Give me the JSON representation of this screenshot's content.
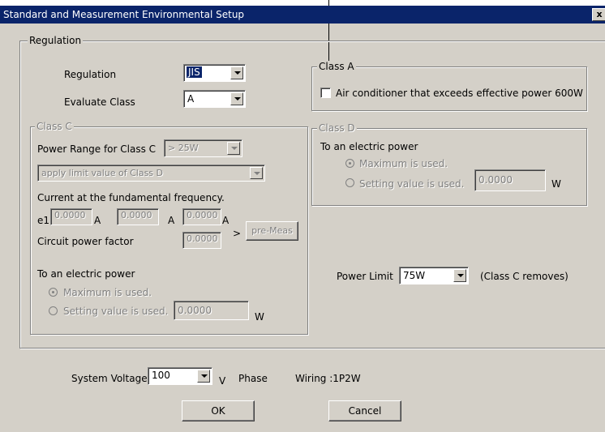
{
  "window": {
    "title": "Standard and Measurement Environmental Setup",
    "close_glyph": "x"
  },
  "regulation_group": {
    "title": "Regulation",
    "regulation_label": "Regulation",
    "regulation_value": "JIS",
    "evaluate_label": "Evaluate Class",
    "evaluate_value": "A"
  },
  "class_a": {
    "title": "Class A",
    "checkbox_label": "Air conditioner that exceeds effective power 600W",
    "checked": false
  },
  "class_c": {
    "title": "Class C",
    "power_range_label": "Power Range for Class C",
    "power_range_value": "> 25W",
    "limit_select_value": "apply limit value of Class D",
    "current_label": "Current at the fundamental frequency.",
    "e1_label": "e1",
    "current_values": [
      "0.0000",
      "0.0000",
      "0.0000"
    ],
    "unit_a": "A",
    "pf_label": "Circuit power factor",
    "pf_value": "0.0000",
    "arrow": ">",
    "pre_meas_label": "pre-Meas",
    "power_title": "To an electric power",
    "max_label": "Maximum is used.",
    "setting_label": "Setting value is used.",
    "setting_value": "0.0000",
    "unit_w": "W"
  },
  "class_d": {
    "title": "Class D",
    "power_title": "To an electric power",
    "max_label": "Maximum is used.",
    "setting_label": "Setting value is used.",
    "setting_value": "0.0000",
    "unit_w": "W"
  },
  "power_limit": {
    "label": "Power Limit",
    "value": "75W",
    "note": "(Class C removes)"
  },
  "system": {
    "voltage_label": "System Voltage",
    "voltage_value": "100",
    "v_unit": "V",
    "phase_label": "Phase",
    "wiring_label": "Wiring :1P2W"
  },
  "buttons": {
    "ok": "OK",
    "cancel": "Cancel"
  }
}
